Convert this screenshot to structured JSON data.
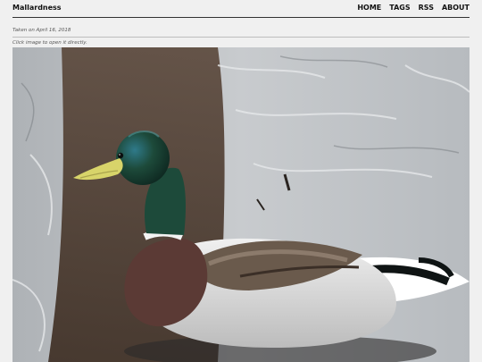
{
  "header": {
    "site_title": "Mallardness",
    "nav": [
      "HOME",
      "TAGS",
      "RSS",
      "ABOUT"
    ]
  },
  "post": {
    "taken_on": "Taken on April 16, 2018",
    "hint": "Click image to open it directly."
  },
  "photo": {
    "subject": "mallard-drake-swimming",
    "colors": {
      "water": "#b9bcbf",
      "reflection": "#4b3a2c",
      "head": "#1d4a3a",
      "beak": "#d8d46a",
      "breast": "#5b3a35",
      "body": "#dcdcdc",
      "wing": "#6a5a4c"
    }
  }
}
